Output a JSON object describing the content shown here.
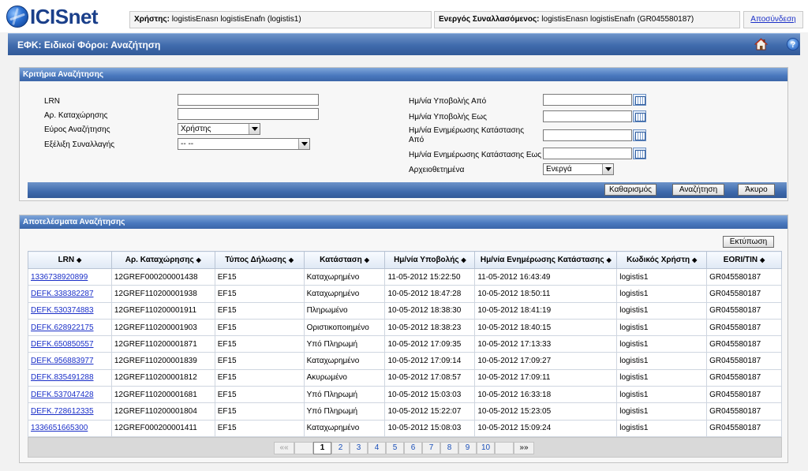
{
  "app": {
    "logo_text": "ICISnet"
  },
  "header": {
    "user_label": "Χρήστης:",
    "user_value": "logistisEnasn logistisEnafn (logistis1)",
    "trader_label": "Ενεργός Συναλλασόμενος:",
    "trader_value": "logistisEnasn logistisEnafn (GR045580187)",
    "logout": "Αποσύνδεση"
  },
  "page": {
    "title": "ΕΦΚ: Ειδικοί Φόροι: Αναζήτηση",
    "help_glyph": "?"
  },
  "criteria": {
    "header": "Κριτήρια Αναζήτησης",
    "lrn_label": "LRN",
    "reg_no_label": "Αρ. Καταχώρησης",
    "range_label": "Εύρος Αναζήτησης",
    "range_value": "Χρήστης",
    "progress_label": "Εξέλιξη Συναλλαγής",
    "progress_value": "-- --",
    "submit_from_label": "Ημ/νία Υποβολής Από",
    "submit_to_label": "Ημ/νία Υποβολής Εως",
    "status_update_from_label_1": "Ημ/νία Ενημέρωσης Κατάστασης",
    "status_update_from_label_2": "Από",
    "status_update_to_label": "Ημ/νία Ενημέρωσης Κατάστασης Εως",
    "archived_label": "Αρχειοθετημένα",
    "archived_value": "Ενεργά",
    "buttons": {
      "clear": "Καθαρισμός",
      "search": "Αναζήτηση",
      "cancel": "Άκυρο"
    }
  },
  "results": {
    "header": "Αποτελέσματα Αναζήτησης",
    "print": "Εκτύπωση",
    "sort_glyph": "◆",
    "columns": [
      "LRN",
      "Αρ. Καταχώρησης",
      "Τύπος Δήλωσης",
      "Κατάσταση",
      "Ημ/νία Υποβολής",
      "Ημ/νία Ενημέρωσης Κατάστασης",
      "Κωδικός Χρήστη",
      "EORI/TIN"
    ],
    "rows": [
      [
        "1336738920899",
        "12GREF000200001438",
        "EF15",
        "Καταχωρημένο",
        "11-05-2012 15:22:50",
        "11-05-2012 16:43:49",
        "logistis1",
        "GR045580187"
      ],
      [
        "DEFK.338382287",
        "12GREF110200001938",
        "EF15",
        "Καταχωρημένο",
        "10-05-2012 18:47:28",
        "10-05-2012 18:50:11",
        "logistis1",
        "GR045580187"
      ],
      [
        "DEFK.530374883",
        "12GREF110200001911",
        "EF15",
        "Πληρωμένο",
        "10-05-2012 18:38:30",
        "10-05-2012 18:41:19",
        "logistis1",
        "GR045580187"
      ],
      [
        "DEFK.628922175",
        "12GREF110200001903",
        "EF15",
        "Οριστικοποιημένο",
        "10-05-2012 18:38:23",
        "10-05-2012 18:40:15",
        "logistis1",
        "GR045580187"
      ],
      [
        "DEFK.650850557",
        "12GREF110200001871",
        "EF15",
        "Υπό Πληρωμή",
        "10-05-2012 17:09:35",
        "10-05-2012 17:13:33",
        "logistis1",
        "GR045580187"
      ],
      [
        "DEFK.956883977",
        "12GREF110200001839",
        "EF15",
        "Καταχωρημένο",
        "10-05-2012 17:09:14",
        "10-05-2012 17:09:27",
        "logistis1",
        "GR045580187"
      ],
      [
        "DEFK.835491288",
        "12GREF110200001812",
        "EF15",
        "Ακυρωμένο",
        "10-05-2012 17:08:57",
        "10-05-2012 17:09:11",
        "logistis1",
        "GR045580187"
      ],
      [
        "DEFK.537047428",
        "12GREF110200001681",
        "EF15",
        "Υπό Πληρωμή",
        "10-05-2012 15:03:03",
        "10-05-2012 16:33:18",
        "logistis1",
        "GR045580187"
      ],
      [
        "DEFK.728612335",
        "12GREF110200001804",
        "EF15",
        "Υπό Πληρωμή",
        "10-05-2012 15:22:07",
        "10-05-2012 15:23:05",
        "logistis1",
        "GR045580187"
      ],
      [
        "1336651665300",
        "12GREF000200001411",
        "EF15",
        "Καταχωρημένο",
        "10-05-2012 15:08:03",
        "10-05-2012 15:09:24",
        "logistis1",
        "GR045580187"
      ]
    ],
    "pager": {
      "first": "««",
      "pages": [
        "1",
        "2",
        "3",
        "4",
        "5",
        "6",
        "7",
        "8",
        "9",
        "10"
      ],
      "current": "1",
      "last": "»»"
    }
  }
}
